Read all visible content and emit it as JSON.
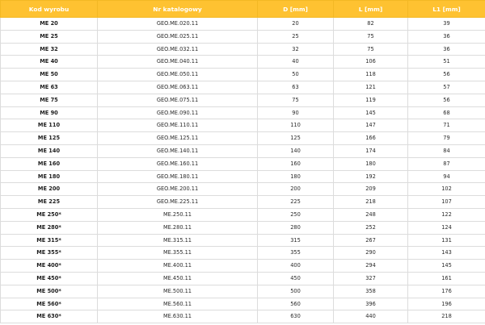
{
  "table": {
    "headers": [
      "Kod wyrobu",
      "Nr katalogowy",
      "D [mm]",
      "L [mm]",
      "L1 [mm]"
    ],
    "rows": [
      [
        "ME 20",
        "GEO.ME.020.11",
        "20",
        "82",
        "39"
      ],
      [
        "ME 25",
        "GEO.ME.025.11",
        "25",
        "75",
        "36"
      ],
      [
        "ME 32",
        "GEO.ME.032.11",
        "32",
        "75",
        "36"
      ],
      [
        "ME 40",
        "GEO.ME.040.11",
        "40",
        "106",
        "51"
      ],
      [
        "ME 50",
        "GEO.ME.050.11",
        "50",
        "118",
        "56"
      ],
      [
        "ME 63",
        "GEO.ME.063.11",
        "63",
        "121",
        "57"
      ],
      [
        "ME 75",
        "GEO.ME.075.11",
        "75",
        "119",
        "56"
      ],
      [
        "ME 90",
        "GEO.ME.090.11",
        "90",
        "145",
        "68"
      ],
      [
        "ME 110",
        "GEO.ME.110.11",
        "110",
        "147",
        "71"
      ],
      [
        "ME 125",
        "GEO.ME.125.11",
        "125",
        "166",
        "79"
      ],
      [
        "ME 140",
        "GEO.ME.140.11",
        "140",
        "174",
        "84"
      ],
      [
        "ME 160",
        "GEO.ME.160.11",
        "160",
        "180",
        "87"
      ],
      [
        "ME 180",
        "GEO.ME.180.11",
        "180",
        "192",
        "94"
      ],
      [
        "ME 200",
        "GEO.ME.200.11",
        "200",
        "209",
        "102"
      ],
      [
        "ME 225",
        "GEO.ME.225.11",
        "225",
        "218",
        "107"
      ],
      [
        "ME 250*",
        "ME.250.11",
        "250",
        "248",
        "122"
      ],
      [
        "ME 280*",
        "ME.280.11",
        "280",
        "252",
        "124"
      ],
      [
        "ME 315*",
        "ME.315.11",
        "315",
        "267",
        "131"
      ],
      [
        "ME 355*",
        "ME.355.11",
        "355",
        "290",
        "143"
      ],
      [
        "ME 400*",
        "ME.400.11",
        "400",
        "294",
        "145"
      ],
      [
        "ME 450*",
        "ME.450.11",
        "450",
        "327",
        "161"
      ],
      [
        "ME 500*",
        "ME.500.11",
        "500",
        "358",
        "176"
      ],
      [
        "ME 560*",
        "ME.560.11",
        "560",
        "396",
        "196"
      ],
      [
        "ME 630*",
        "ME.630.11",
        "630",
        "440",
        "218"
      ]
    ]
  },
  "colors": {
    "header_background": "#fec231",
    "header_text": "#ffffff",
    "grid_lines": "#dcdcdc"
  }
}
